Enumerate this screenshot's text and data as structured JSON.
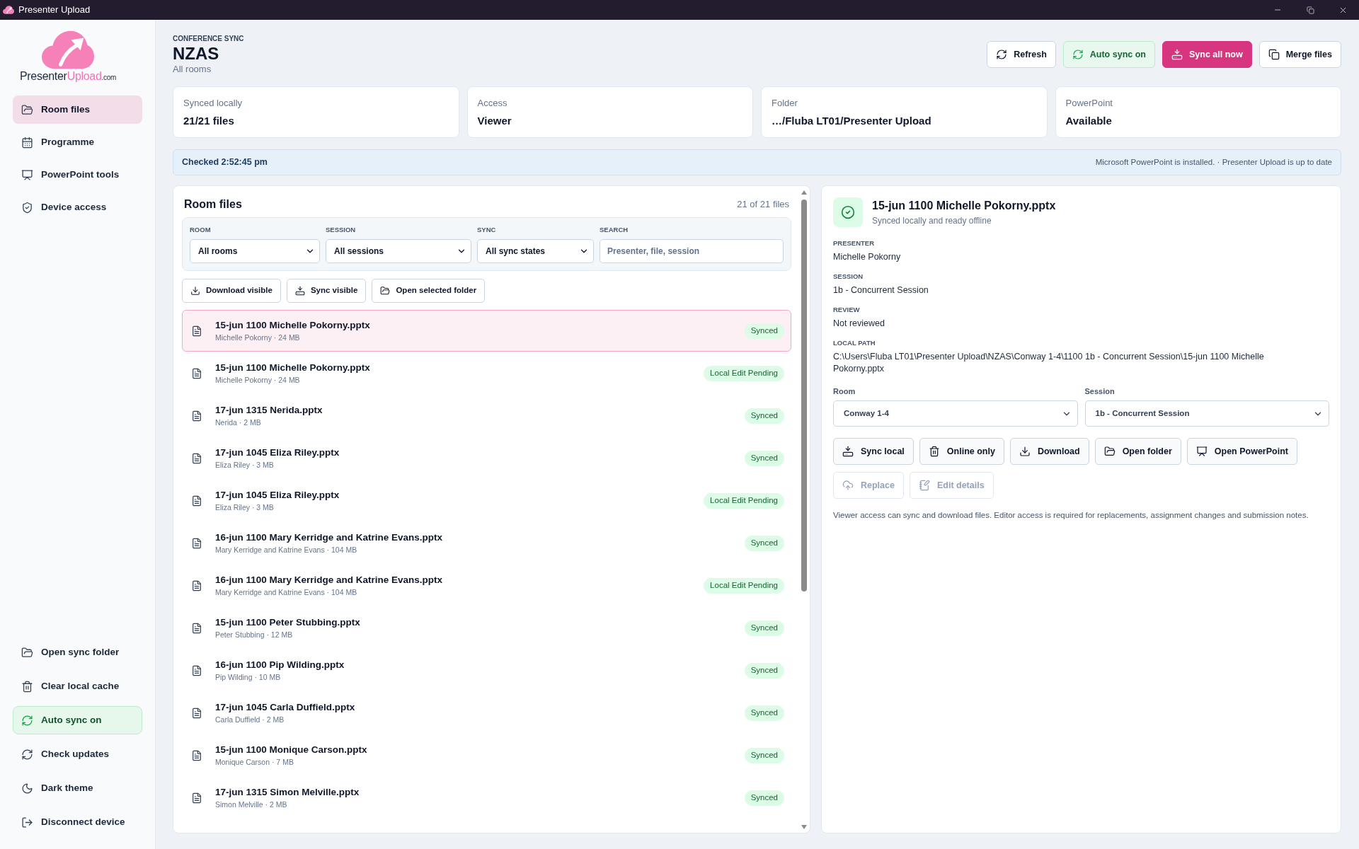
{
  "window": {
    "title": "Presenter Upload"
  },
  "sidebar": {
    "logo": {
      "text": "Presenter",
      "accent": "Upload",
      "suffix": ".com"
    },
    "nav": [
      {
        "label": "Room files",
        "selected": true
      },
      {
        "label": "Programme",
        "selected": false
      },
      {
        "label": "PowerPoint tools",
        "selected": false
      },
      {
        "label": "Device access",
        "selected": false
      }
    ],
    "actions": [
      {
        "label": "Open sync folder",
        "on": false
      },
      {
        "label": "Clear local cache",
        "on": false
      },
      {
        "label": "Auto sync on",
        "on": true
      },
      {
        "label": "Check updates",
        "on": false
      },
      {
        "label": "Dark theme",
        "on": false
      },
      {
        "label": "Disconnect device",
        "on": false
      }
    ]
  },
  "header": {
    "eyebrow": "CONFERENCE SYNC",
    "title": "NZAS",
    "subtitle": "All rooms",
    "buttons": [
      {
        "label": "Refresh",
        "kind": "default"
      },
      {
        "label": "Auto sync on",
        "kind": "success"
      },
      {
        "label": "Sync all now",
        "kind": "primary"
      },
      {
        "label": "Merge files",
        "kind": "default"
      }
    ]
  },
  "stats": [
    {
      "label": "Synced locally",
      "value": "21/21 files"
    },
    {
      "label": "Access",
      "value": "Viewer"
    },
    {
      "label": "Folder",
      "value": "…/Fluba LT01/Presenter Upload"
    },
    {
      "label": "PowerPoint",
      "value": "Available"
    }
  ],
  "status": {
    "checked": "Checked 2:52:45 pm",
    "message": "Microsoft PowerPoint is installed. · Presenter Upload is up to date"
  },
  "room_files": {
    "title": "Room files",
    "count": "21 of 21 files",
    "filters": [
      {
        "kind": "select",
        "label": "ROOM",
        "value": "All rooms"
      },
      {
        "kind": "select",
        "label": "SESSION",
        "value": "All sessions"
      },
      {
        "kind": "select",
        "label": "SYNC",
        "value": "All sync states"
      },
      {
        "kind": "search",
        "label": "SEARCH",
        "placeholder": "Presenter, file, session"
      }
    ],
    "actions": [
      "Download visible",
      "Sync visible",
      "Open selected folder"
    ],
    "files": [
      {
        "name": "15-jun 1100 Michelle Pokorny.pptx",
        "meta": "Michelle Pokorny · 24 MB",
        "status": "Synced",
        "selected": true
      },
      {
        "name": "15-jun 1100 Michelle Pokorny.pptx",
        "meta": "Michelle Pokorny · 24 MB",
        "status": "Local Edit Pending",
        "selected": false
      },
      {
        "name": "17-jun 1315 Nerida.pptx",
        "meta": "Nerida · 2 MB",
        "status": "Synced",
        "selected": false
      },
      {
        "name": "17-jun 1045 Eliza Riley.pptx",
        "meta": "Eliza Riley · 3 MB",
        "status": "Synced",
        "selected": false
      },
      {
        "name": "17-jun 1045 Eliza Riley.pptx",
        "meta": "Eliza Riley · 3 MB",
        "status": "Local Edit Pending",
        "selected": false
      },
      {
        "name": "16-jun 1100 Mary Kerridge and Katrine Evans.pptx",
        "meta": "Mary Kerridge and Katrine Evans · 104 MB",
        "status": "Synced",
        "selected": false
      },
      {
        "name": "16-jun 1100 Mary Kerridge and Katrine Evans.pptx",
        "meta": "Mary Kerridge and Katrine Evans · 104 MB",
        "status": "Local Edit Pending",
        "selected": false
      },
      {
        "name": "15-jun 1100 Peter Stubbing.pptx",
        "meta": "Peter Stubbing · 12 MB",
        "status": "Synced",
        "selected": false
      },
      {
        "name": "16-jun 1100 Pip Wilding.pptx",
        "meta": "Pip Wilding · 10 MB",
        "status": "Synced",
        "selected": false
      },
      {
        "name": "17-jun 1045 Carla Duffield.pptx",
        "meta": "Carla Duffield · 2 MB",
        "status": "Synced",
        "selected": false
      },
      {
        "name": "15-jun 1100 Monique Carson.pptx",
        "meta": "Monique Carson · 7 MB",
        "status": "Synced",
        "selected": false
      },
      {
        "name": "17-jun 1315 Simon Melville.pptx",
        "meta": "Simon Melville · 2 MB",
        "status": "Synced",
        "selected": false
      }
    ]
  },
  "detail": {
    "title": "15-jun 1100 Michelle Pokorny.pptx",
    "subtitle": "Synced locally and ready offline",
    "fields": [
      {
        "label": "PRESENTER",
        "value": "Michelle Pokorny"
      },
      {
        "label": "SESSION",
        "value": "1b - Concurrent Session"
      },
      {
        "label": "REVIEW",
        "value": "Not reviewed"
      },
      {
        "label": "LOCAL PATH",
        "value": "C:\\Users\\Fluba LT01\\Presenter Upload\\NZAS\\Conway 1-4\\1100 1b - Concurrent Session\\15-jun 1100 Michelle Pokorny.pptx"
      }
    ],
    "selects": [
      {
        "label": "Room",
        "value": "Conway 1-4"
      },
      {
        "label": "Session",
        "value": "1b - Concurrent Session"
      }
    ],
    "actions": [
      {
        "label": "Sync local",
        "disabled": false
      },
      {
        "label": "Online only",
        "disabled": false
      },
      {
        "label": "Download",
        "disabled": false
      },
      {
        "label": "Open folder",
        "disabled": false
      },
      {
        "label": "Open PowerPoint",
        "disabled": false
      },
      {
        "label": "Replace",
        "disabled": true
      },
      {
        "label": "Edit details",
        "disabled": true
      }
    ],
    "note": "Viewer access can sync and download files. Editor access is required for replacements, assignment changes and submission notes."
  }
}
